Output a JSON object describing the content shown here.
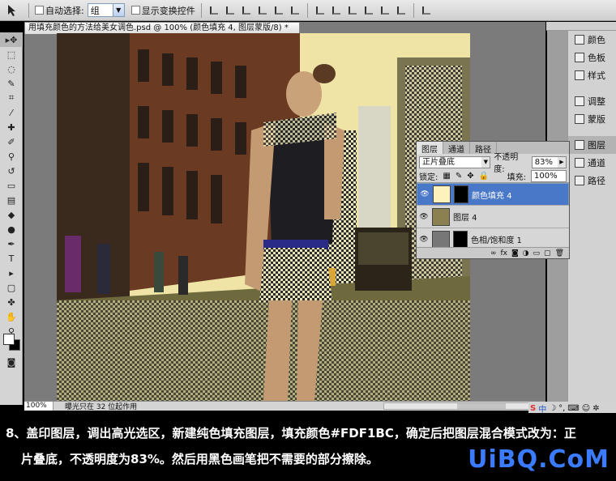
{
  "options_bar": {
    "tool_icon": "move-tool-icon",
    "auto_select_label": "自动选择:",
    "auto_select_value": "组",
    "show_transform_label": "显示变换控件"
  },
  "document": {
    "tab_title": "用填充颜色的方法给美女调色.psd @ 100% (颜色填充 4, 图层蒙版/8) *",
    "zoom": "100%",
    "status_info": "曝光只在 32 位起作用"
  },
  "right_dock": {
    "items": [
      "颜色",
      "色板",
      "样式",
      "调整",
      "蒙版",
      "图层",
      "通道",
      "路径"
    ]
  },
  "layers_panel": {
    "tabs": [
      "图层",
      "通道",
      "路径"
    ],
    "blend_mode": "正片叠底",
    "opacity_label": "不透明度:",
    "opacity_value": "83%",
    "lock_label": "锁定:",
    "fill_label": "填充:",
    "fill_value": "100%",
    "layers": [
      {
        "name": "颜色填充 4",
        "selected": true,
        "thumb_color": "#FDF1BC"
      },
      {
        "name": "图层 4",
        "selected": false,
        "thumb_color": "#8a8050"
      },
      {
        "name": "色相/饱和度 1",
        "selected": false,
        "thumb_color": "#777777"
      }
    ]
  },
  "tray": {
    "items": [
      "S",
      "中"
    ]
  },
  "caption": {
    "line1": "8、盖印图层，调出高光选区，新建纯色填充图层，填充颜色#FDF1BC，确定后把图层混合模式改为：正",
    "line2": "片叠底，不透明度为83%。然后用黑色画笔把不需要的部分擦除。",
    "brand": "UiBQ.CoM"
  },
  "colors": {
    "fill_color": "#FDF1BC",
    "selection_blue": "#4a78c8",
    "brand_blue": "#3a7bff"
  }
}
